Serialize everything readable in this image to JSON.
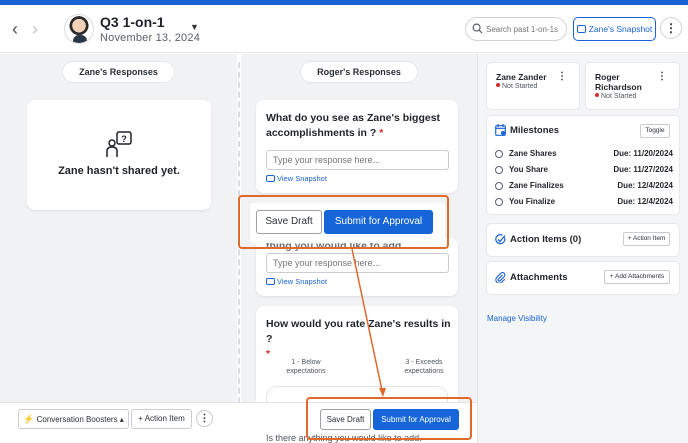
{
  "header": {
    "title": "Q3 1-on-1",
    "date": "November 13, 2024",
    "search_placeholder": "Search past 1-on-1s",
    "snapshot_label": "Zane's Snapshot",
    "accent_color": "#1a63d6"
  },
  "left": {
    "tab_label": "Zane's Responses",
    "empty_message": "Zane hasn't shared yet."
  },
  "middle": {
    "tab_label": "Roger's Responses",
    "questions": [
      {
        "text": "What do you see as Zane's biggest accomplishments in ?",
        "required": "*",
        "placeholder": "Type your response here...",
        "snapshot_link": "View Snapshot"
      },
      {
        "text": "thing you would like to add.",
        "placeholder": "Type your response here...",
        "snapshot_link": "View Snapshot"
      },
      {
        "text": "How would you rate Zane's results in ?",
        "required": "*",
        "low_label": "1 - Below expectations",
        "high_label": "3 - Exceeds expectations"
      }
    ],
    "floating_actions": {
      "save_draft": "Save Draft",
      "submit": "Submit for Approval"
    },
    "cut_text": "Is there anything you would like to add."
  },
  "bottom_toolbar": {
    "boosters": "Conversation Boosters",
    "action_item": "+ Action Item",
    "save_draft": "Save Draft",
    "submit": "Submit for Approval"
  },
  "right": {
    "people": [
      {
        "name": "Zane Zander",
        "status": "Not Started"
      },
      {
        "name": "Roger Richardson",
        "status": "Not Started"
      }
    ],
    "milestones": {
      "title": "Milestones",
      "toggle": "Toggle",
      "items": [
        {
          "name": "Zane Shares",
          "due": "Due: 11/20/2024"
        },
        {
          "name": "You Share",
          "due": "Due: 11/27/2024"
        },
        {
          "name": "Zane Finalizes",
          "due": "Due: 12/4/2024"
        },
        {
          "name": "You Finalize",
          "due": "Due: 12/4/2024"
        }
      ]
    },
    "action_items": {
      "title": "Action Items (0)",
      "button": "+ Action Item"
    },
    "attachments": {
      "title": "Attachments",
      "button": "+ Add Attachments"
    },
    "manage_visibility": "Manage Visibility"
  },
  "highlight_color": "#e06a2a"
}
